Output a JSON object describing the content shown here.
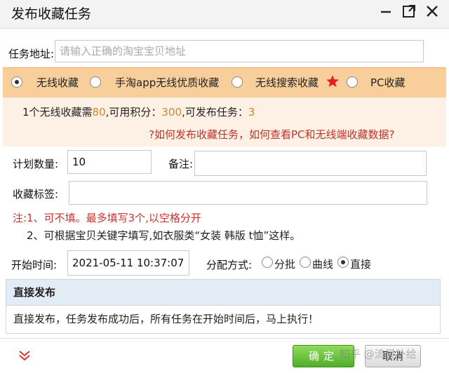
{
  "window": {
    "title": "发布收藏任务"
  },
  "form": {
    "address_label": "任务地址:",
    "address_placeholder": "请输入正确的淘宝宝贝地址",
    "task_types": [
      {
        "label": "无线收藏",
        "checked": true
      },
      {
        "label": "手淘app无线优质收藏",
        "checked": false
      },
      {
        "label": "无线搜索收藏",
        "checked": false,
        "icon": "star-icon"
      },
      {
        "label": "PC收藏",
        "checked": false
      }
    ],
    "info": {
      "prefix": "1个无线收藏需",
      "cost": "80",
      "mid1": ",可用积分：",
      "points": "300",
      "mid2": ",可发布任务：",
      "tasks": "3"
    },
    "help_link": "?如何发布收藏任务，如何查看PC和无线端收藏数据?",
    "plan_label": "计划数量:",
    "plan_value": "10",
    "remark_label": "备注:",
    "remark_value": "",
    "tags_label": "收藏标签:",
    "tags_value": "",
    "note1": "注:1、可不填。最多填写3个,以空格分开",
    "note2": "2、可根据宝贝关键字填写,如衣服类“女装 韩版 t恤”这样。",
    "start_label": "开始时间:",
    "start_value": "2021-05-11 10:37:07",
    "dist_label": "分配方式:",
    "dist_options": [
      {
        "label": "分批",
        "checked": false
      },
      {
        "label": "曲线",
        "checked": false
      },
      {
        "label": "直接",
        "checked": true
      }
    ]
  },
  "section": {
    "heading": "直接发布",
    "body": "直接发布，任务发布成功后，所有任务在开始时间后，马上执行！"
  },
  "footer": {
    "confirm": "确定",
    "cancel": "取消",
    "watermark": "知乎 @流量补给"
  },
  "colors": {
    "accent_orange": "#f8cf9a",
    "link_red": "#c0332b",
    "confirm_green": "#4fae2a"
  }
}
